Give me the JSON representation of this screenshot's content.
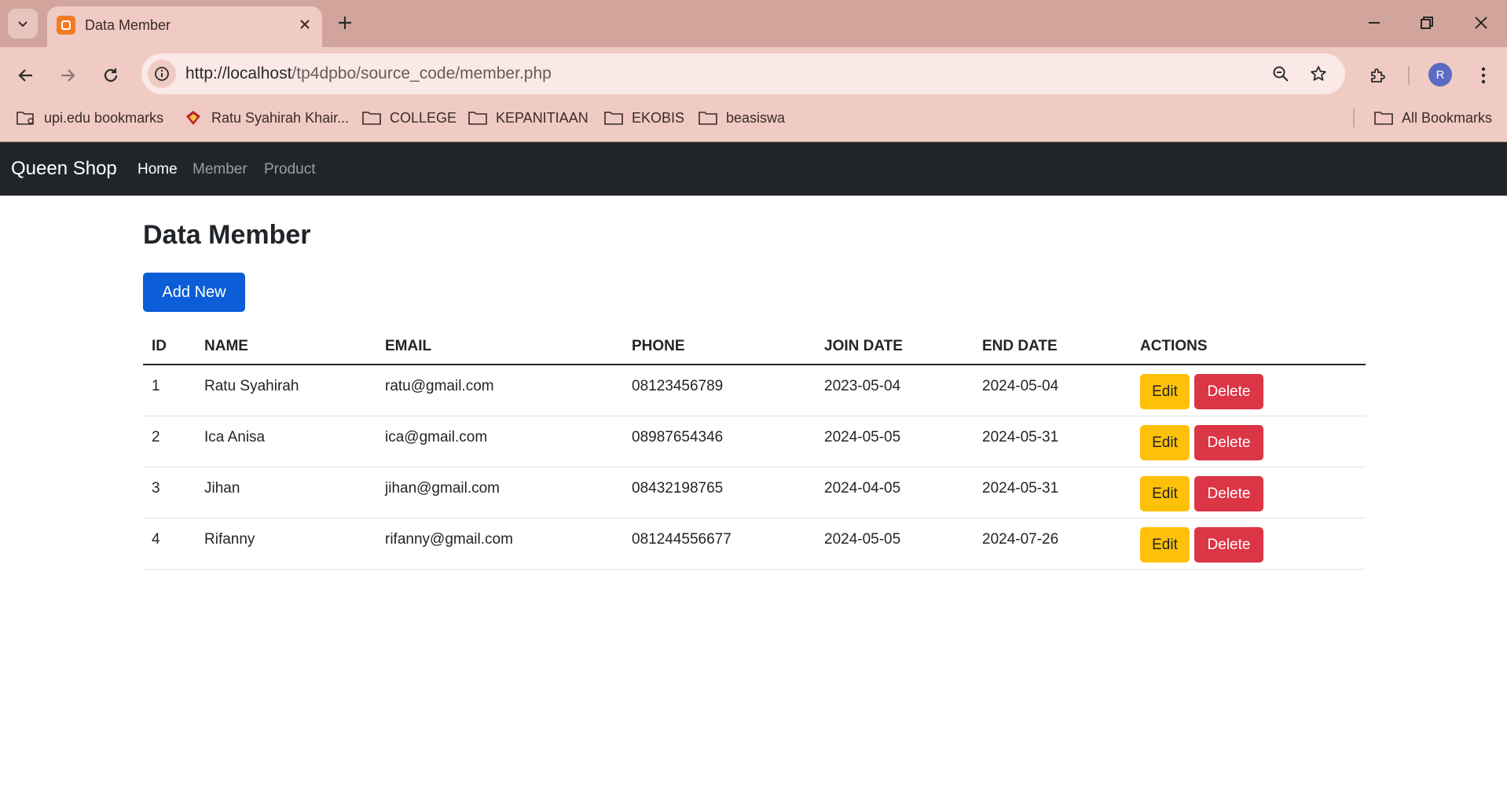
{
  "browser": {
    "tab": {
      "title": "Data Member"
    },
    "url": {
      "host": "http://localhost",
      "path": "/tp4dpbo/source_code/member.php"
    },
    "bookmarks": [
      {
        "label": "upi.edu bookmarks",
        "icon": "managed-folder-icon"
      },
      {
        "label": "Ratu Syahirah Khair...",
        "icon": "site-favicon-icon"
      },
      {
        "label": "COLLEGE",
        "icon": "folder-icon"
      },
      {
        "label": "KEPANITIAAN",
        "icon": "folder-icon"
      },
      {
        "label": "EKOBIS",
        "icon": "folder-icon"
      },
      {
        "label": "beasiswa",
        "icon": "folder-icon"
      }
    ],
    "all_bookmarks": "All Bookmarks",
    "profile_initial": "R",
    "colors": {
      "tabstrip": "#d1a59b",
      "toolbar": "#efcbc4",
      "omnibox": "#fae9e6"
    }
  },
  "navbar": {
    "brand": "Queen Shop",
    "links": [
      {
        "label": "Home",
        "active": true
      },
      {
        "label": "Member",
        "active": false
      },
      {
        "label": "Product",
        "active": false
      }
    ],
    "color": "#212529"
  },
  "main": {
    "title": "Data Member",
    "add_button": "Add New",
    "table": {
      "headers": [
        "ID",
        "NAME",
        "EMAIL",
        "PHONE",
        "JOIN DATE",
        "END DATE",
        "ACTIONS"
      ],
      "rows": [
        {
          "id": "1",
          "name": "Ratu Syahirah",
          "email": "ratu@gmail.com",
          "phone": "08123456789",
          "join": "2023-05-04",
          "end": "2024-05-04"
        },
        {
          "id": "2",
          "name": "Ica Anisa",
          "email": "ica@gmail.com",
          "phone": "08987654346",
          "join": "2024-05-05",
          "end": "2024-05-31"
        },
        {
          "id": "3",
          "name": "Jihan",
          "email": "jihan@gmail.com",
          "phone": "08432198765",
          "join": "2024-04-05",
          "end": "2024-05-31"
        },
        {
          "id": "4",
          "name": "Rifanny",
          "email": "rifanny@gmail.com",
          "phone": "081244556677",
          "join": "2024-05-05",
          "end": "2024-07-26"
        }
      ],
      "edit_label": "Edit",
      "delete_label": "Delete"
    },
    "colors": {
      "primary": "#0b5ed7",
      "warning": "#ffc107",
      "danger": "#dc3545"
    }
  }
}
